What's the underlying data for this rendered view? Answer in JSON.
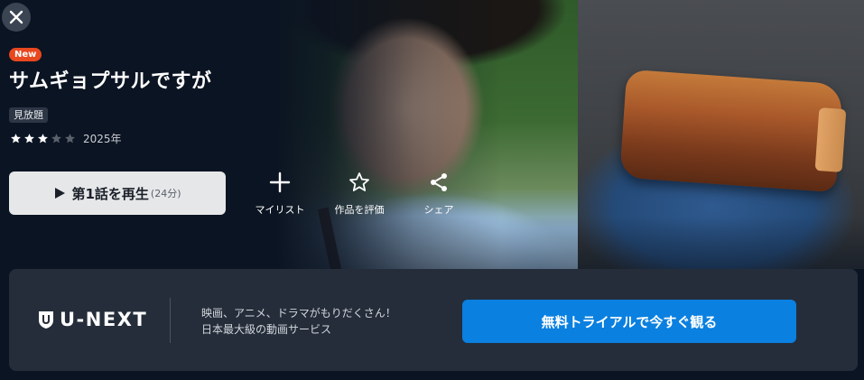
{
  "header": {
    "close_icon": "close-icon"
  },
  "content": {
    "badge": "New",
    "title": "サムギョプサルですが",
    "tag": "見放題",
    "rating": {
      "value": 3,
      "max": 5
    },
    "year": "2025年"
  },
  "actions": {
    "play_label": "第1話を再生",
    "play_duration": "(24分)",
    "mylist_label": "マイリスト",
    "rate_label": "作品を評価",
    "share_label": "シェア"
  },
  "banner": {
    "logo_text": "U-NEXT",
    "promo_line1": "映画、アニメ、ドラマがもりだくさん！",
    "promo_line2": "日本最大級の動画サービス",
    "cta_label": "無料トライアルで今すぐ観る"
  },
  "colors": {
    "background": "#0b1422",
    "badge": "#e8481f",
    "cta": "#0a80e0",
    "banner": "#252d3a",
    "star_filled": "#ffffff",
    "star_empty": "#5a616c"
  }
}
